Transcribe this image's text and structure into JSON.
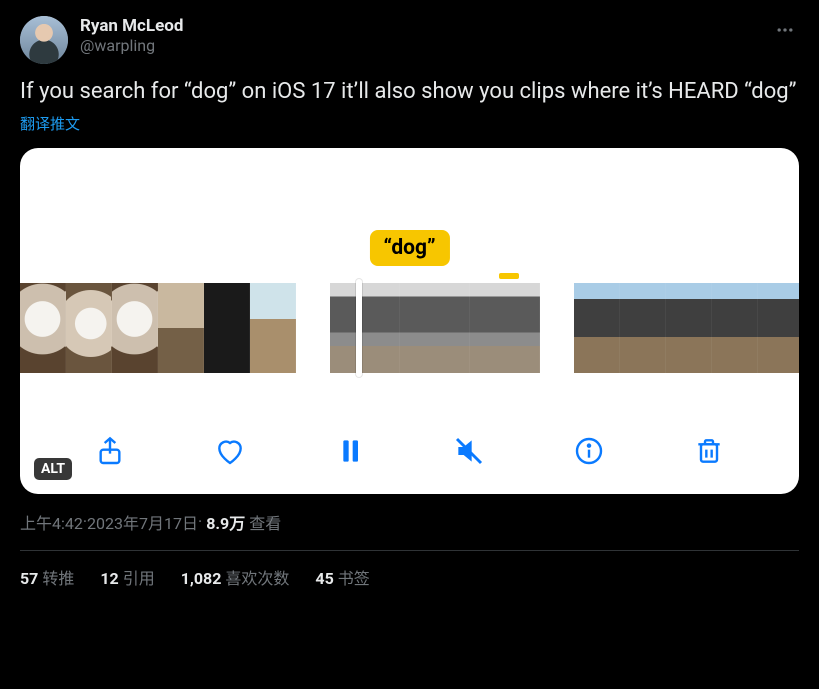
{
  "author": {
    "display_name": "Ryan McLeod",
    "handle": "@warpling"
  },
  "content": {
    "text": "If you search for “dog” on iOS 17 it’ll also show you clips where it’s HEARD “dog”",
    "translate_label": "翻译推文"
  },
  "media": {
    "alt_badge": "ALT",
    "caption_bubble": "“dog”"
  },
  "timestamp": {
    "time": "上午4:42",
    "dot1": " · ",
    "date": "2023年7月17日",
    "dot2": " · ",
    "views_count": "8.9万",
    "views_label": " 查看"
  },
  "stats": {
    "retweet_count": "57",
    "retweet_label": "转推",
    "quote_count": "12",
    "quote_label": "引用",
    "like_count": "1,082",
    "like_label": "喜欢次数",
    "bookmark_count": "45",
    "bookmark_label": "书签"
  }
}
